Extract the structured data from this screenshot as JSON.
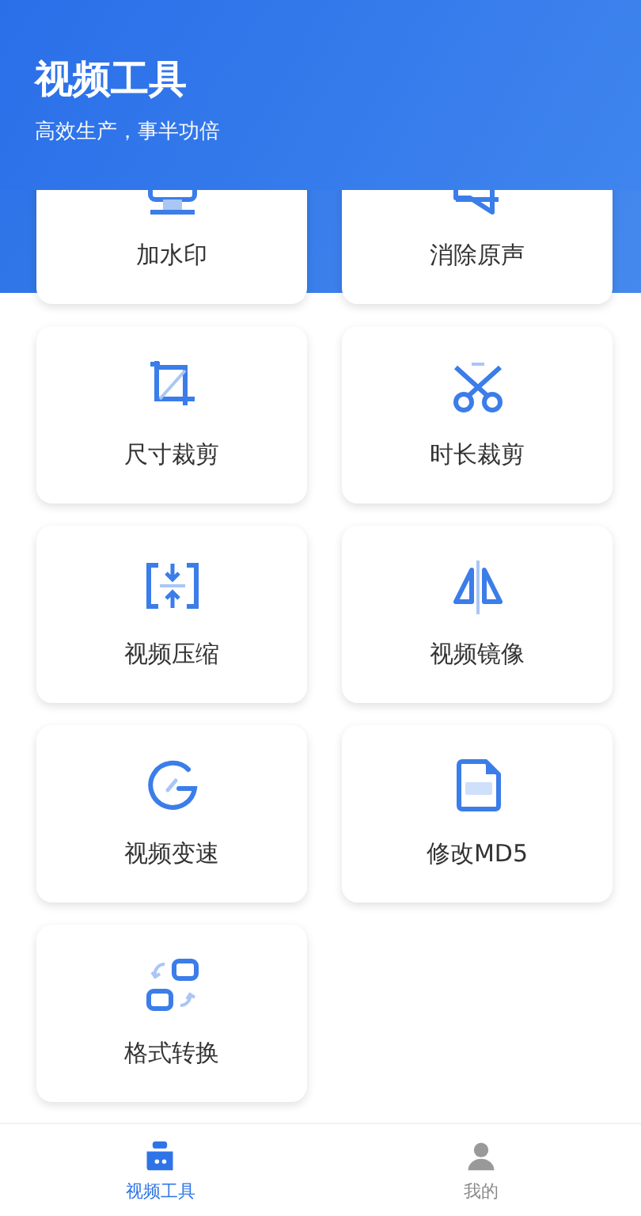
{
  "header": {
    "title": "视频工具",
    "subtitle": "高效生产，事半功倍"
  },
  "tools": [
    {
      "label": "加水印",
      "kind": "watermark"
    },
    {
      "label": "消除原声",
      "kind": "mute"
    },
    {
      "label": "尺寸裁剪",
      "kind": "crop"
    },
    {
      "label": "时长裁剪",
      "kind": "trim"
    },
    {
      "label": "视频压缩",
      "kind": "compress"
    },
    {
      "label": "视频镜像",
      "kind": "mirror"
    },
    {
      "label": "视频变速",
      "kind": "speed"
    },
    {
      "label": "修改MD5",
      "kind": "md5"
    },
    {
      "label": "格式转换",
      "kind": "convert"
    }
  ],
  "tab_bar": [
    {
      "label": "视频工具",
      "kind": "camera",
      "selected": true
    },
    {
      "label": "我的",
      "kind": "person",
      "selected": false
    }
  ]
}
